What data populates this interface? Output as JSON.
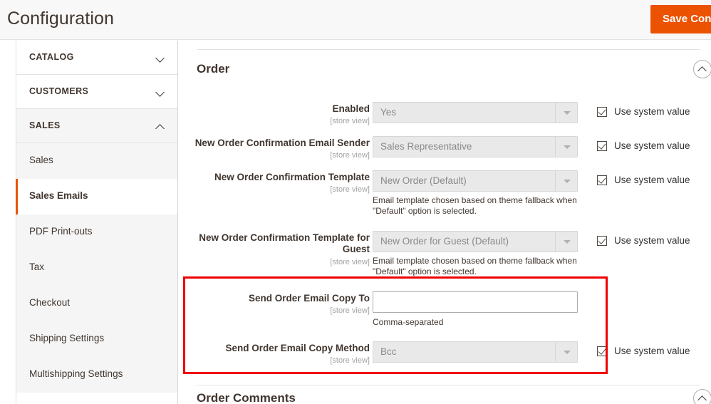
{
  "header": {
    "title": "Configuration",
    "save_label": "Save Config"
  },
  "sidebar": {
    "sections": [
      {
        "label": "CATALOG",
        "state": "collapsed",
        "icon": "chevron-down-icon"
      },
      {
        "label": "CUSTOMERS",
        "state": "collapsed",
        "icon": "chevron-down-icon"
      },
      {
        "label": "SALES",
        "state": "expanded",
        "icon": "chevron-up-icon"
      }
    ],
    "sales_items": [
      {
        "label": "Sales",
        "active": false
      },
      {
        "label": "Sales Emails",
        "active": true
      },
      {
        "label": "PDF Print-outs",
        "active": false
      },
      {
        "label": "Tax",
        "active": false
      },
      {
        "label": "Checkout",
        "active": false
      },
      {
        "label": "Shipping Settings",
        "active": false
      },
      {
        "label": "Multishipping Settings",
        "active": false
      }
    ]
  },
  "sections": {
    "order": {
      "title": "Order",
      "toggle_icon": "collapse-circle-up-icon"
    },
    "order_comments": {
      "title": "Order Comments",
      "toggle_icon": "collapse-circle-up-icon"
    }
  },
  "scope_label": "[store view]",
  "use_system_value_label": "Use system value",
  "fields": {
    "enabled": {
      "label": "Enabled",
      "value": "Yes",
      "use_system": true
    },
    "sender": {
      "label": "New Order Confirmation Email Sender",
      "value": "Sales Representative",
      "use_system": true
    },
    "template": {
      "label": "New Order Confirmation Template",
      "value": "New Order (Default)",
      "note": "Email template chosen based on theme fallback when \"Default\" option is selected.",
      "use_system": true
    },
    "template_guest": {
      "label": "New Order Confirmation Template for Guest",
      "value": "New Order for Guest (Default)",
      "note": "Email template chosen based on theme fallback when \"Default\" option is selected.",
      "use_system": true
    },
    "copy_to": {
      "label": "Send Order Email Copy To",
      "value": "",
      "placeholder": "",
      "note": "Comma-separated"
    },
    "copy_method": {
      "label": "Send Order Email Copy Method",
      "value": "Bcc",
      "use_system": true
    }
  },
  "colors": {
    "accent": "#eb5202",
    "highlight": "#ef0000",
    "text": "#41362f",
    "header_bg": "#f8f8f8"
  }
}
